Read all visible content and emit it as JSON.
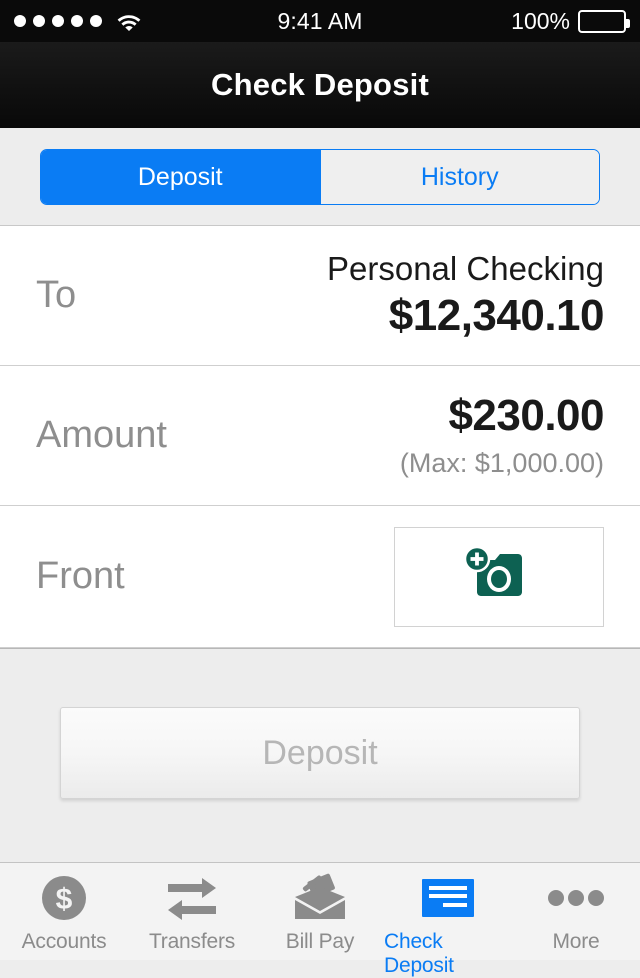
{
  "status_bar": {
    "signal_dots": 5,
    "wifi_icon": "wifi-icon",
    "time": "9:41 AM",
    "battery_percent": "100%",
    "battery_icon": "battery-full-icon"
  },
  "navbar": {
    "title": "Check Deposit"
  },
  "segmented_control": {
    "options": [
      {
        "label": "Deposit",
        "active": true
      },
      {
        "label": "History",
        "active": false
      }
    ],
    "active_color": "#0a7cf4"
  },
  "form": {
    "to": {
      "label": "To",
      "account_name": "Personal Checking",
      "account_balance": "$12,340.10"
    },
    "amount": {
      "label": "Amount",
      "value": "$230.00",
      "max_note": "(Max: $1,000.00)"
    },
    "front": {
      "label": "Front",
      "capture_icon": "camera-add-icon",
      "icon_color": "#0d6152"
    }
  },
  "action": {
    "deposit_button": {
      "label": "Deposit",
      "disabled": true
    }
  },
  "tabbar": {
    "items": [
      {
        "label": "Accounts",
        "icon": "dollar-circle-icon",
        "active": false
      },
      {
        "label": "Transfers",
        "icon": "transfer-arrows-icon",
        "active": false
      },
      {
        "label": "Bill Pay",
        "icon": "envelope-bills-icon",
        "active": false
      },
      {
        "label": "Check Deposit",
        "icon": "check-document-icon",
        "active": true
      },
      {
        "label": "More",
        "icon": "ellipsis-icon",
        "active": false
      }
    ],
    "active_color": "#0a7cf4",
    "inactive_color": "#8b8b8b"
  }
}
